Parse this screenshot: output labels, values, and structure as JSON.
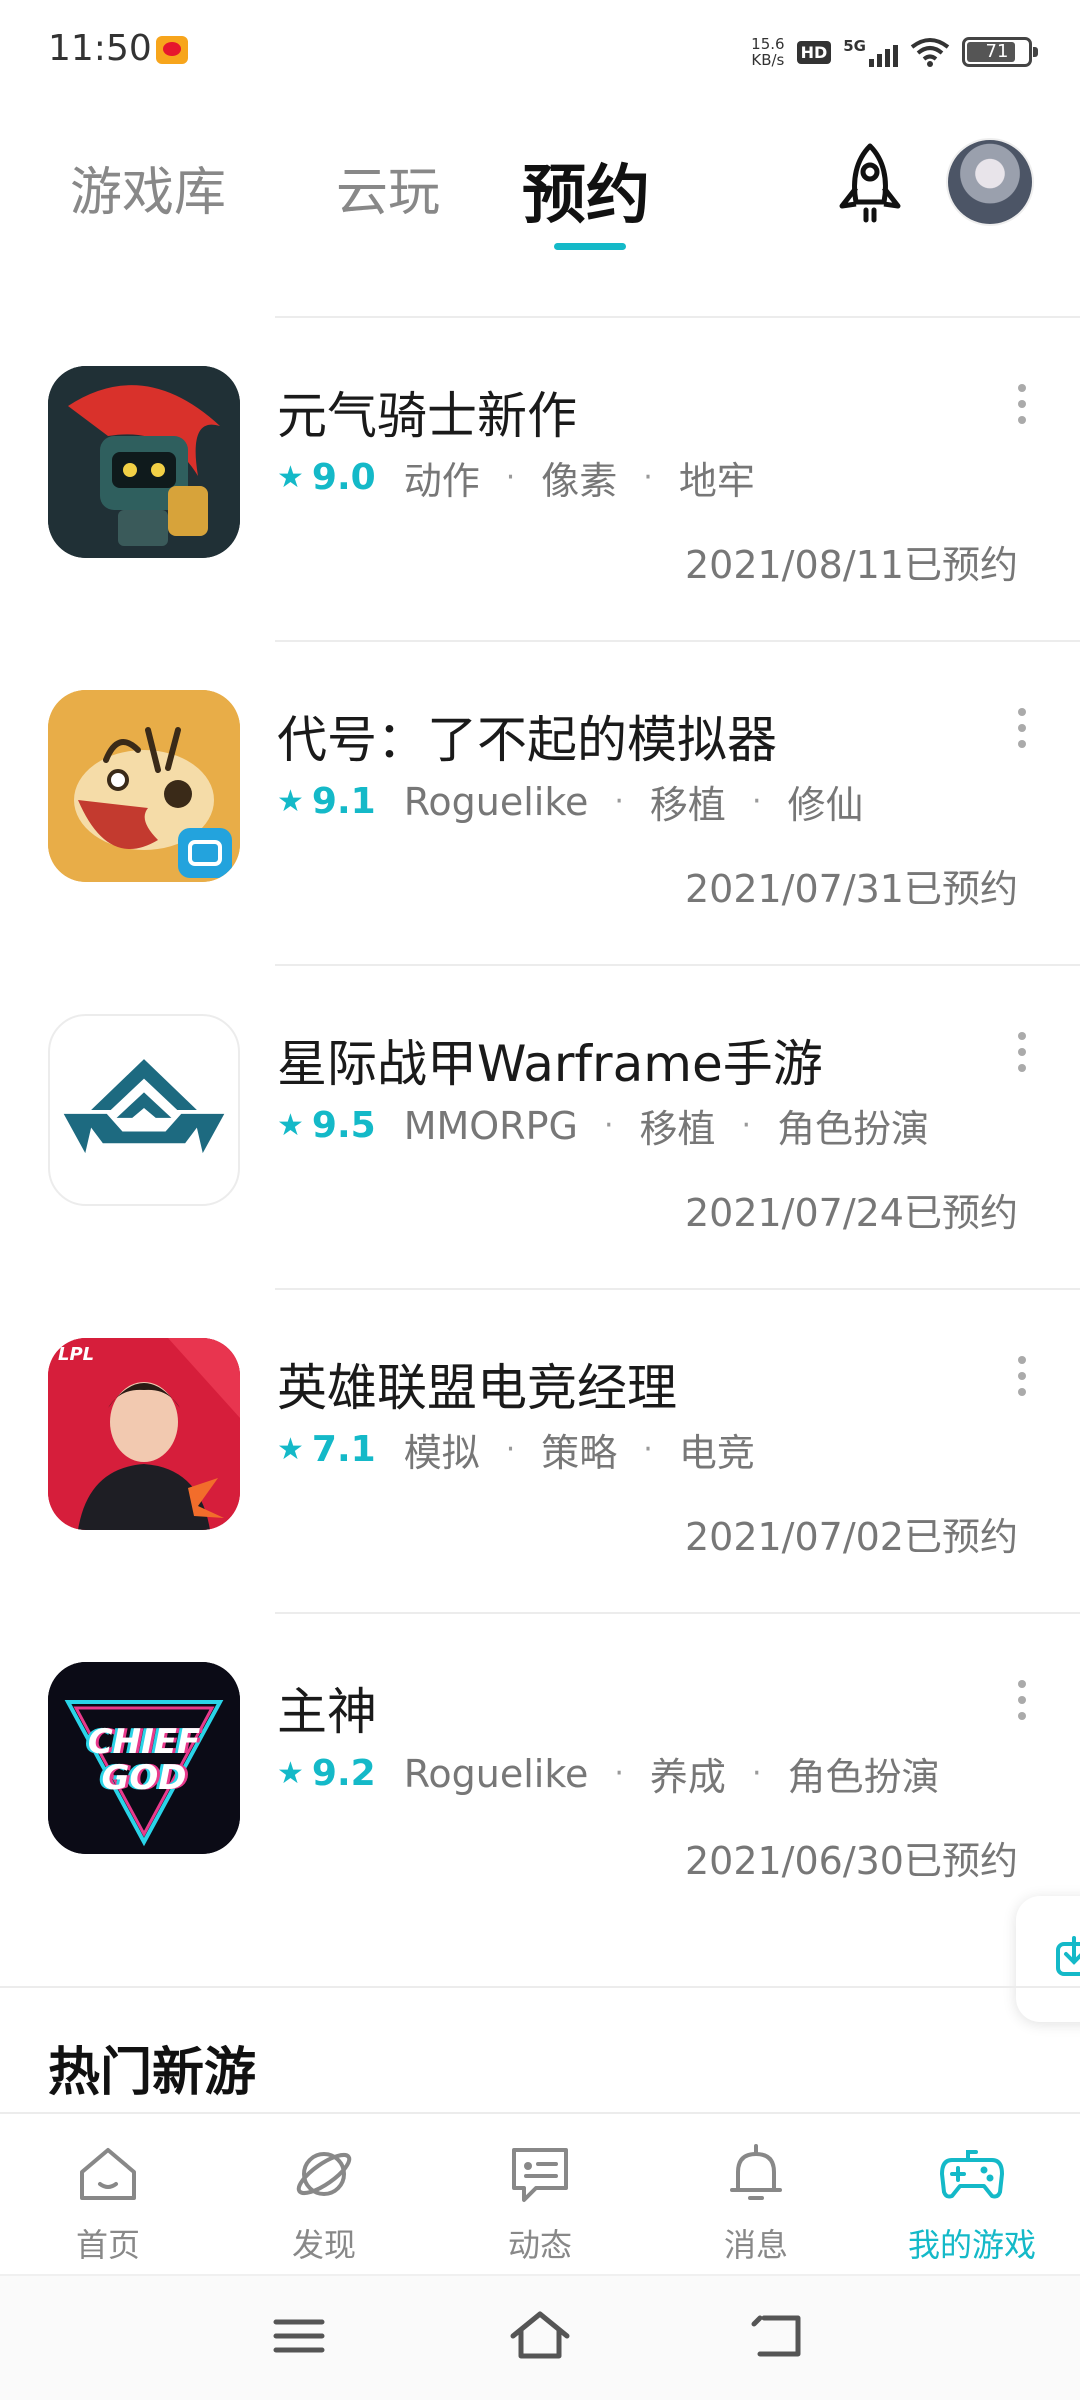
{
  "status_bar": {
    "time": "11:50",
    "net_speed_value": "15.6",
    "net_speed_unit": "KB/s",
    "hd": "HD",
    "network": "5G",
    "battery": "71"
  },
  "tabs": [
    {
      "label": "游戏库",
      "active": false
    },
    {
      "label": "云玩",
      "active": false
    },
    {
      "label": "预约",
      "active": true
    }
  ],
  "games": [
    {
      "name": "元气骑士新作",
      "score": "9.0",
      "tags": [
        "动作",
        "像素",
        "地牢"
      ],
      "date": "2021/08/11已预约"
    },
    {
      "name": "代号：了不起的模拟器",
      "score": "9.1",
      "tags": [
        "Roguelike",
        "移植",
        "修仙"
      ],
      "date": "2021/07/31已预约"
    },
    {
      "name": "星际战甲Warframe手游",
      "score": "9.5",
      "tags": [
        "MMORPG",
        "移植",
        "角色扮演"
      ],
      "date": "2021/07/24已预约"
    },
    {
      "name": "英雄联盟电竞经理",
      "score": "7.1",
      "tags": [
        "模拟",
        "策略",
        "电竞"
      ],
      "date": "2021/07/02已预约"
    },
    {
      "name": "主神",
      "score": "9.2",
      "tags": [
        "Roguelike",
        "养成",
        "角色扮演"
      ],
      "date": "2021/06/30已预约"
    }
  ],
  "icons": {
    "lpl_badge": "LPL",
    "chief_god_line1": "CHIEF",
    "chief_god_line2": "GOD"
  },
  "section": {
    "hot_new": "热门新游"
  },
  "bottom_nav": [
    {
      "label": "首页",
      "icon": "home-icon",
      "active": false
    },
    {
      "label": "发现",
      "icon": "planet-icon",
      "active": false
    },
    {
      "label": "动态",
      "icon": "chat-icon",
      "active": false
    },
    {
      "label": "消息",
      "icon": "bell-icon",
      "active": false
    },
    {
      "label": "我的游戏",
      "icon": "gamepad-icon",
      "active": true
    }
  ],
  "colors": {
    "accent": "#14b9c8",
    "text": "#1a1a1a",
    "muted": "#777777"
  }
}
